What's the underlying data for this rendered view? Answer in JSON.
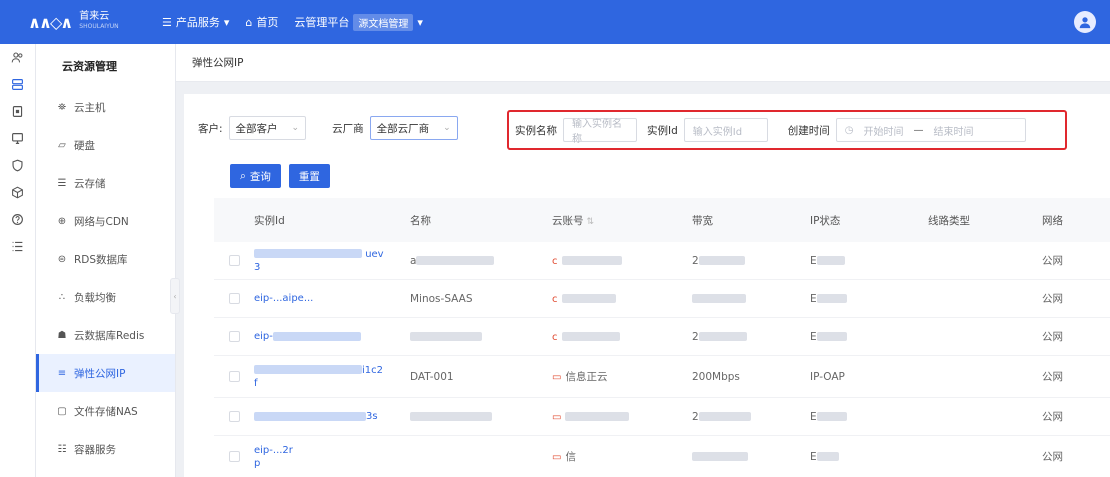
{
  "topbar": {
    "logo_mark": "∧∧◇∧",
    "logo_name": "首来云",
    "logo_sub": "SHOULAIYUN",
    "nav": [
      {
        "icon": "menu-icon",
        "label": "产品服务",
        "dropdown": true
      },
      {
        "icon": "home-icon",
        "label": "首页",
        "dropdown": false
      },
      {
        "icon": "",
        "label": "云管理平台",
        "dropdown": false
      }
    ],
    "platform_badge": "源文档管理",
    "accent": "#2f66e0"
  },
  "rail": {
    "icons": [
      "users-icon",
      "server-icon",
      "document-icon",
      "monitor-icon",
      "shield-icon",
      "cube-icon",
      "help-icon",
      "list-icon"
    ]
  },
  "menu": {
    "title": "云资源管理",
    "items": [
      {
        "icon": "⛯",
        "label": "云主机"
      },
      {
        "icon": "▱",
        "label": "硬盘"
      },
      {
        "icon": "☰",
        "label": "云存储"
      },
      {
        "icon": "⊕",
        "label": "网络与CDN"
      },
      {
        "icon": "⊜",
        "label": "RDS数据库"
      },
      {
        "icon": "∴",
        "label": "负载均衡"
      },
      {
        "icon": "☗",
        "label": "云数据库Redis"
      },
      {
        "icon": "≡",
        "label": "弹性公网IP",
        "active": true
      },
      {
        "icon": "▢",
        "label": "文件存储NAS"
      },
      {
        "icon": "☷",
        "label": "容器服务"
      }
    ]
  },
  "breadcrumb": "弹性公网IP",
  "filters": {
    "customer_label": "客户:",
    "customer_value": "全部客户",
    "vendor_label": "云厂商",
    "vendor_value": "全部云厂商",
    "instance_name_label": "实例名称",
    "instance_name_placeholder": "输入实例名称",
    "instance_id_label": "实例Id",
    "instance_id_placeholder": "输入实例Id",
    "created_label": "创建时间",
    "start_placeholder": "开始时间",
    "range_sep": "—",
    "end_placeholder": "结束时间",
    "highlight_color": "#e0282e"
  },
  "buttons": {
    "query": "查询",
    "reset": "重置"
  },
  "table": {
    "headers": {
      "id": "实例Id",
      "name": "名称",
      "account": "云账号",
      "bandwidth": "带宽",
      "ip_status": "IP状态",
      "line_type": "线路类型",
      "network": "网络"
    },
    "rows": [
      {
        "id_l1": "uev",
        "id_l2": "3",
        "name": "a",
        "account": "c",
        "bandwidth": "2",
        "status": "E",
        "network": "公网"
      },
      {
        "id_l1": "eip-...aipe...",
        "id_l2": "",
        "name": "Minos-SAAS",
        "account": "c",
        "bandwidth": "...",
        "status": "E",
        "network": "公网"
      },
      {
        "id_l1": "eip-",
        "id_l2": "",
        "name": "",
        "account": "c",
        "bandwidth": "2",
        "status": "E",
        "network": "公网"
      },
      {
        "id_l1": "i1c2",
        "id_l2": "f",
        "name": "DAT-001",
        "account": "信息正云",
        "bandwidth": "200Mbps",
        "status": "IP-OAP",
        "network": "公网"
      },
      {
        "id_l1": "3s",
        "id_l2": "",
        "name": "",
        "account": "",
        "bandwidth": "2",
        "status": "E",
        "network": "公网"
      },
      {
        "id_l1": "eip-...2r",
        "id_l2": "p",
        "name": "",
        "account": "信",
        "bandwidth": "",
        "status": "E",
        "network": "公网"
      }
    ]
  }
}
